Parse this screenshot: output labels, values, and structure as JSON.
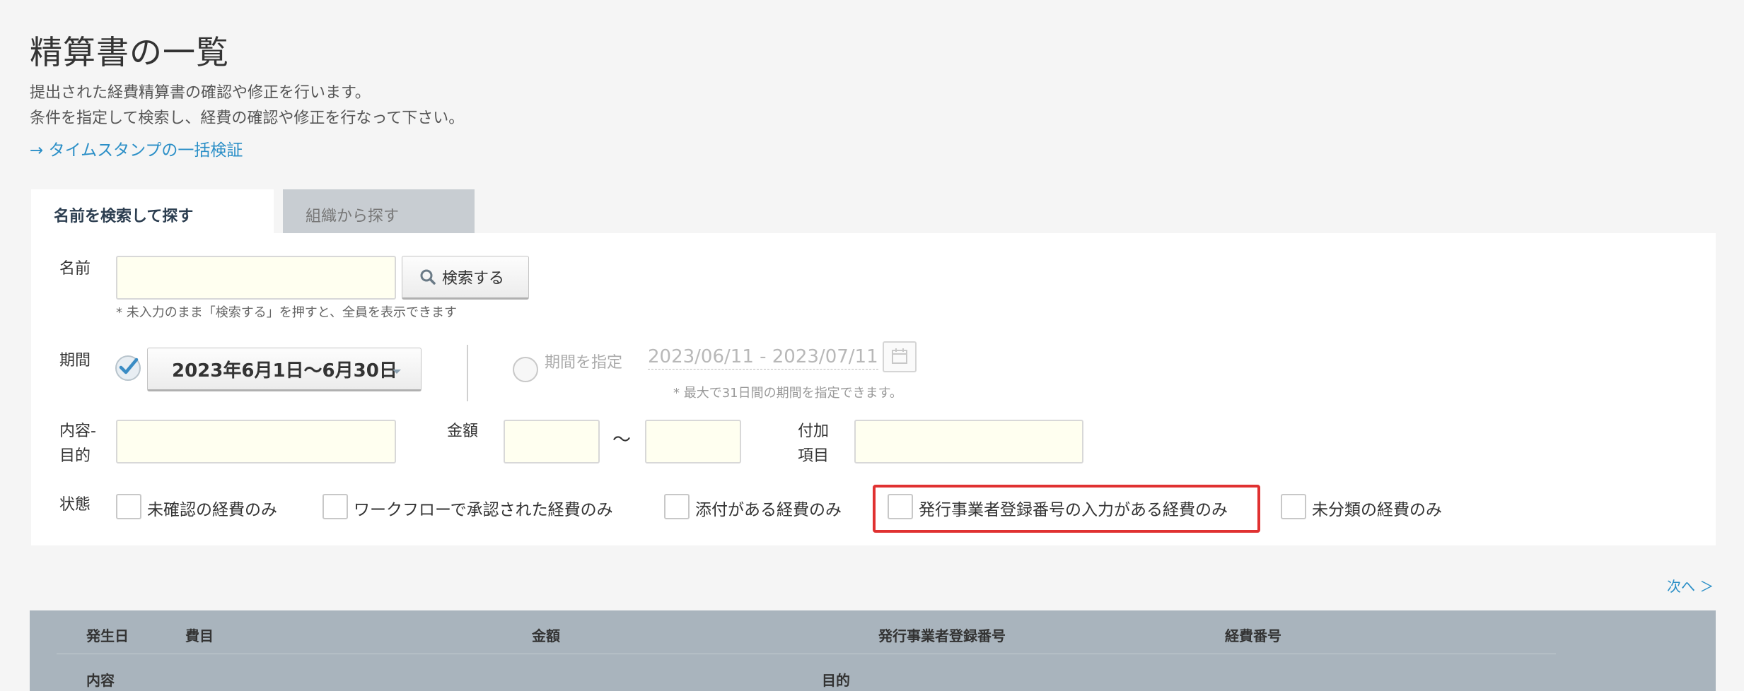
{
  "header": {
    "title": "精算書の一覧",
    "desc_line1": "提出された経費精算書の確認や修正を行います。",
    "desc_line2": "条件を指定して検索し、経費の確認や修正を行なって下さい。",
    "timestamp_link": "→ タイムスタンプの一括検証"
  },
  "tabs": [
    {
      "label": "名前を検索して探す",
      "active": true
    },
    {
      "label": "組織から探す",
      "active": false
    }
  ],
  "form": {
    "name_label": "名前",
    "name_value": "",
    "search_button": "検索する",
    "name_hint": "* 未入力のまま「検索する」を押すと、全員を表示できます",
    "period_label": "期間",
    "period_select": "2023年6月1日〜6月30日",
    "specify_period_label": "期間を指定",
    "date_range": "2023/06/11 - 2023/07/11",
    "date_hint": "* 最大で31日間の期間を指定できます。",
    "content_label_1": "内容-",
    "content_label_2": "目的",
    "amount_label": "金額",
    "tilde": "〜",
    "extra_label_1": "付加",
    "extra_label_2": "項目",
    "status_label": "状態",
    "status_options": [
      "未確認の経費のみ",
      "ワークフローで承認された経費のみ",
      "添付がある経費のみ",
      "発行事業者登録番号の入力がある経費のみ",
      "未分類の経費のみ"
    ]
  },
  "pagination": {
    "next": "次へ ＞"
  },
  "table": {
    "headers_row1": [
      "発生日",
      "費目",
      "金額",
      "発行事業者登録番号",
      "経費番号"
    ],
    "headers_row2": [
      "内容",
      "目的"
    ]
  },
  "colors": {
    "accent_link": "#2b8fc7",
    "highlight": "#e03131",
    "check_blue": "#3a8cc4"
  }
}
